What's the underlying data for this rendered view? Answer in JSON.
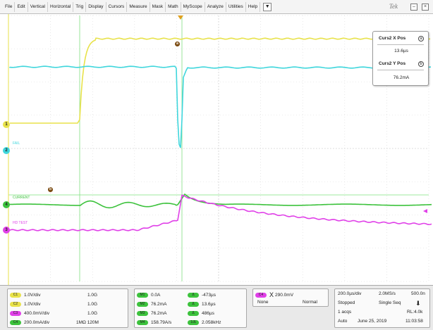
{
  "menu": {
    "items": [
      "File",
      "Edit",
      "Vertical",
      "Horizontal",
      "Trig",
      "Display",
      "Cursors",
      "Measure",
      "Mask",
      "Math",
      "MyScope",
      "Analyze",
      "Utilities",
      "Help"
    ],
    "dropdown_glyph": "▼",
    "brand": "Tek",
    "minimize_glyph": "–",
    "close_glyph": "×"
  },
  "colors": {
    "ch1": "#e8e24a",
    "ch2": "#3fd6dc",
    "ch3": "#e040e8",
    "ch4": "#3cc23c",
    "cursor": "#7fe07f",
    "grid": "#d8d8d8"
  },
  "cursor_readout": {
    "x_title": "Curs2 X Pos",
    "x_badge": "a",
    "x_value": "13.6µs",
    "y_title": "Curs2 Y Pos",
    "y_badge": "b",
    "y_value": "76.2mA"
  },
  "screen_labels": {
    "ch1_marker": "1",
    "ch2_marker": "2",
    "ch4_marker": "4",
    "ch3_marker": "3",
    "ch2_name": "FAIL",
    "ch4_name": "CURRENT",
    "ch3_name": "HD TEST",
    "cursor_a": "a",
    "cursor_b": "b"
  },
  "channels": [
    {
      "badge": "C1",
      "scale": "1.0V/div",
      "coupling": "1.0G",
      "color_key": "ch1"
    },
    {
      "badge": "C2",
      "scale": "1.0V/div",
      "coupling": "1.0G",
      "color_key": "ch2"
    },
    {
      "badge": "C3",
      "scale": "400.0mV/div",
      "coupling": "1.0G",
      "color_key": "ch3"
    },
    {
      "badge": "C4",
      "scale": "200.0mA/div",
      "coupling": "1MΩ 120M",
      "color_key": "ch4"
    }
  ],
  "measurements": [
    {
      "badge": "M1",
      "left": "0.0A",
      "right_badge": "Δ",
      "right": "-473µs"
    },
    {
      "badge": "M2",
      "left": "76.2mA",
      "right_badge": "Δ",
      "right": "13.6µs"
    },
    {
      "badge": "M3",
      "left": "76.2mA",
      "right_badge": "Δ",
      "right": "486µs"
    },
    {
      "badge": "M4",
      "left": "158.79A/s",
      "right_badge": "1/Δ",
      "right": "2.058kHz"
    }
  ],
  "trigger": {
    "badge": "C4",
    "glyph": "X",
    "level": "290.0mV",
    "mode_left": "None",
    "mode_right": "Normal"
  },
  "acquisition": {
    "timebase": "200.0µs/div",
    "sample_rate": "2.0MS/s",
    "record": "500.0n",
    "state": "Stopped",
    "seq_mode": "Single Seq",
    "acqs": "1 acqs",
    "rl": "RL:4.0k",
    "run_mode": "Auto",
    "date": "June 25, 2019",
    "time": "11:03:58"
  }
}
